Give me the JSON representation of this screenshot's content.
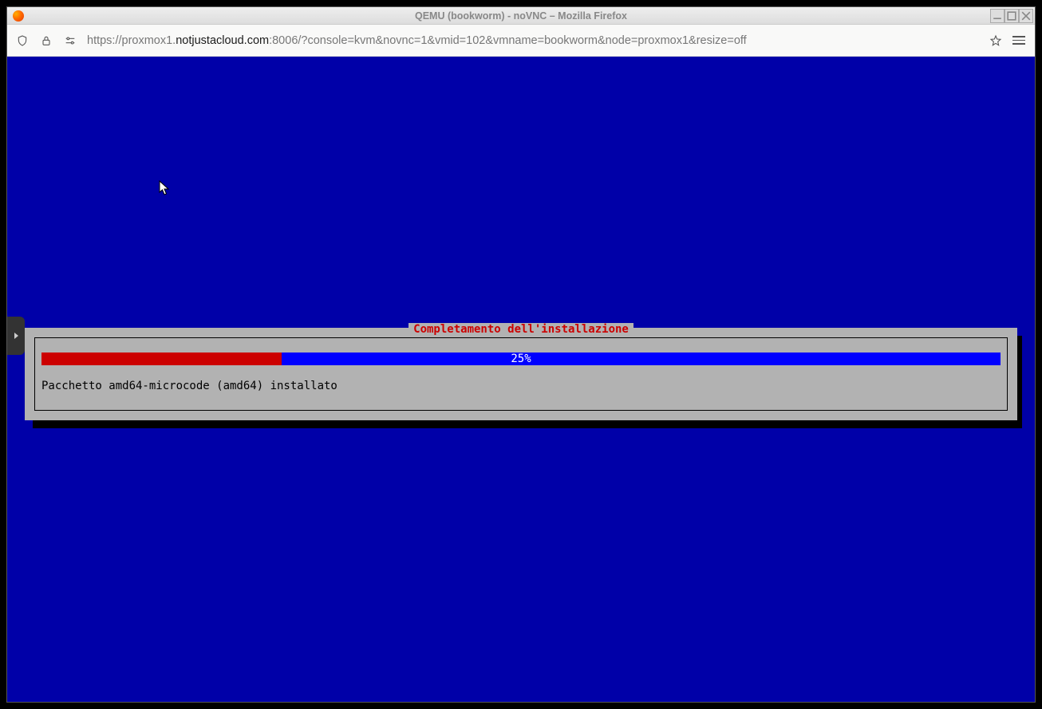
{
  "window": {
    "title": "QEMU (bookworm) - noVNC – Mozilla Firefox"
  },
  "browser": {
    "url_prefix": "https://proxmox1.",
    "url_host_dark": "notjustacloud.com",
    "url_suffix": ":8006/?console=kvm&novnc=1&vmid=102&vmname=bookworm&node=proxmox1&resize=off"
  },
  "installer": {
    "title": "Completamento dell'installazione",
    "progress_pct": 25,
    "progress_label": "25%",
    "status": "Pacchetto amd64-microcode (amd64) installato"
  },
  "colors": {
    "console_bg": "#0000a8",
    "dialog_bg": "#b2b2b2",
    "progress_fill": "#cc0000",
    "progress_track": "#0000ff",
    "title_fg": "#cc0000"
  }
}
